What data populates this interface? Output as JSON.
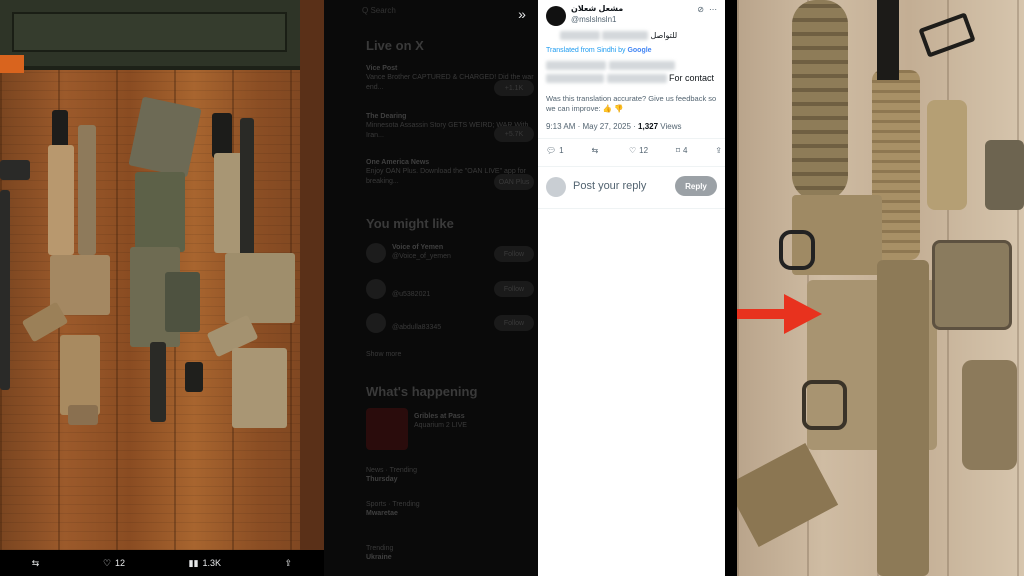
{
  "left_photo": {
    "actions": {
      "retweet_icon": "retweet-icon",
      "like_count": "12",
      "views_count": "1.3K",
      "share_icon": "share-icon"
    }
  },
  "middle": {
    "search_placeholder": "Q Search",
    "live_heading": "Live on X",
    "live_items": [
      {
        "source": "Vice Post",
        "text": "Vance Brother CAPTURED & CHARGED! Did the war end...",
        "pill": "+1.1K"
      },
      {
        "source": "The Dearing",
        "text": "Minnesota Assassin Story GETS WEIRD; WAR With Iran...",
        "pill": "+5.7K"
      },
      {
        "source": "One America News",
        "text": "Enjoy OAN Plus. Download the \"OAN LIVE\" app for breaking...",
        "pill": "OAN Plus"
      }
    ],
    "who_heading": "You might like",
    "who_items": [
      {
        "name": "Voice of Yemen",
        "handle": "@Voice_of_yemen",
        "button": "Follow"
      },
      {
        "name": "",
        "handle": "@u5382021",
        "button": "Follow"
      },
      {
        "name": "",
        "handle": "@abdulla83345",
        "button": "Follow"
      },
      {
        "name": "Show more",
        "handle": "",
        "button": ""
      }
    ],
    "happening_heading": "What's happening",
    "happening_items": [
      {
        "label": "Gribles at Pass",
        "meta": "Aquarium 2 LIVE"
      },
      {
        "label": "Thursday",
        "meta": "News · Trending"
      },
      {
        "label": "Mwaretae",
        "meta": "Sports · Trending"
      },
      {
        "label": "Ukraine",
        "meta": "Trending"
      }
    ]
  },
  "tweet": {
    "display_name": "مشعل شعلان",
    "handle": "@mslslnsln1",
    "arabic_text": "للتواصل",
    "translated_label": "Translated from Sindhi by",
    "google_label": "Google",
    "english_tail": "For contact",
    "feedback_text": "Was this translation accurate? Give us feedback so we can improve:",
    "time": "9:13 AM · May 27, 2025 · ",
    "views_count": "1,327",
    "views_label": " Views",
    "replies": "1",
    "retweets": "",
    "likes": "12",
    "bookmarks": "4",
    "reply_placeholder": "Post your reply",
    "reply_button": "Reply"
  },
  "colors": {
    "arrow": "#e8321e",
    "link_blue": "#1d9bf0"
  }
}
